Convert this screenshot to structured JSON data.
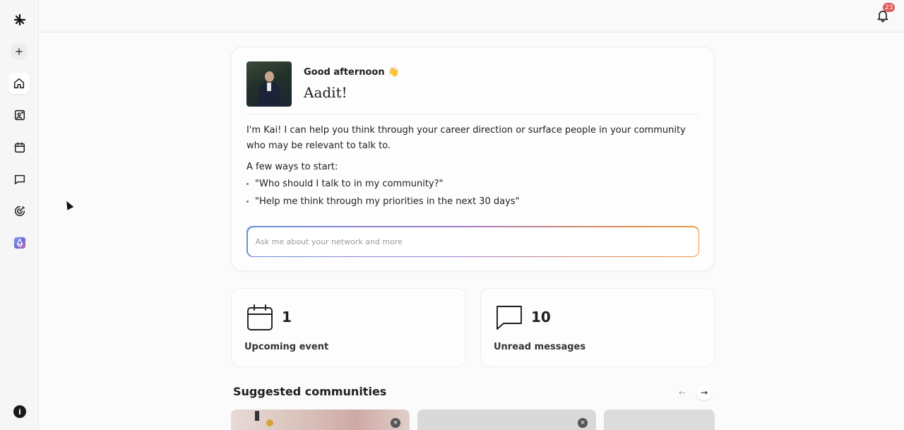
{
  "sidebar": {
    "logo": "ᴋ",
    "help_label": "i",
    "items": [
      {
        "name": "new",
        "icon": "plus-icon"
      },
      {
        "name": "home",
        "icon": "home-icon",
        "active": true
      },
      {
        "name": "contacts",
        "icon": "contact-card-icon"
      },
      {
        "name": "events",
        "icon": "calendar-icon"
      },
      {
        "name": "messages",
        "icon": "chat-icon"
      },
      {
        "name": "activity",
        "icon": "radar-icon"
      },
      {
        "name": "app",
        "icon": "app-logo-icon"
      }
    ]
  },
  "topbar": {
    "notification_count": "23"
  },
  "kai": {
    "greeting": "Good afternoon 👋",
    "name": "Aadit!",
    "intro": "I'm Kai! I can help you think through your career direction or surface people in your community who may be relevant to talk to.",
    "start_label": "A few ways to start:",
    "suggestions": [
      "\"Who should I talk to in my community?\"",
      "\"Help me think through my priorities in the next 30 days\""
    ],
    "input_placeholder": "Ask me about your network and more",
    "input_value": ""
  },
  "stats": {
    "events": {
      "count": "1",
      "label": "Upcoming event"
    },
    "messages": {
      "count": "10",
      "label": "Unread messages"
    }
  },
  "communities": {
    "title": "Suggested communities",
    "prev_arrow": "←",
    "next_arrow": "→",
    "close_glyph": "×"
  },
  "colors": {
    "accent_gradient_start": "#6b8fd6",
    "accent_gradient_end": "#e7993f",
    "badge": "#e05a57"
  }
}
